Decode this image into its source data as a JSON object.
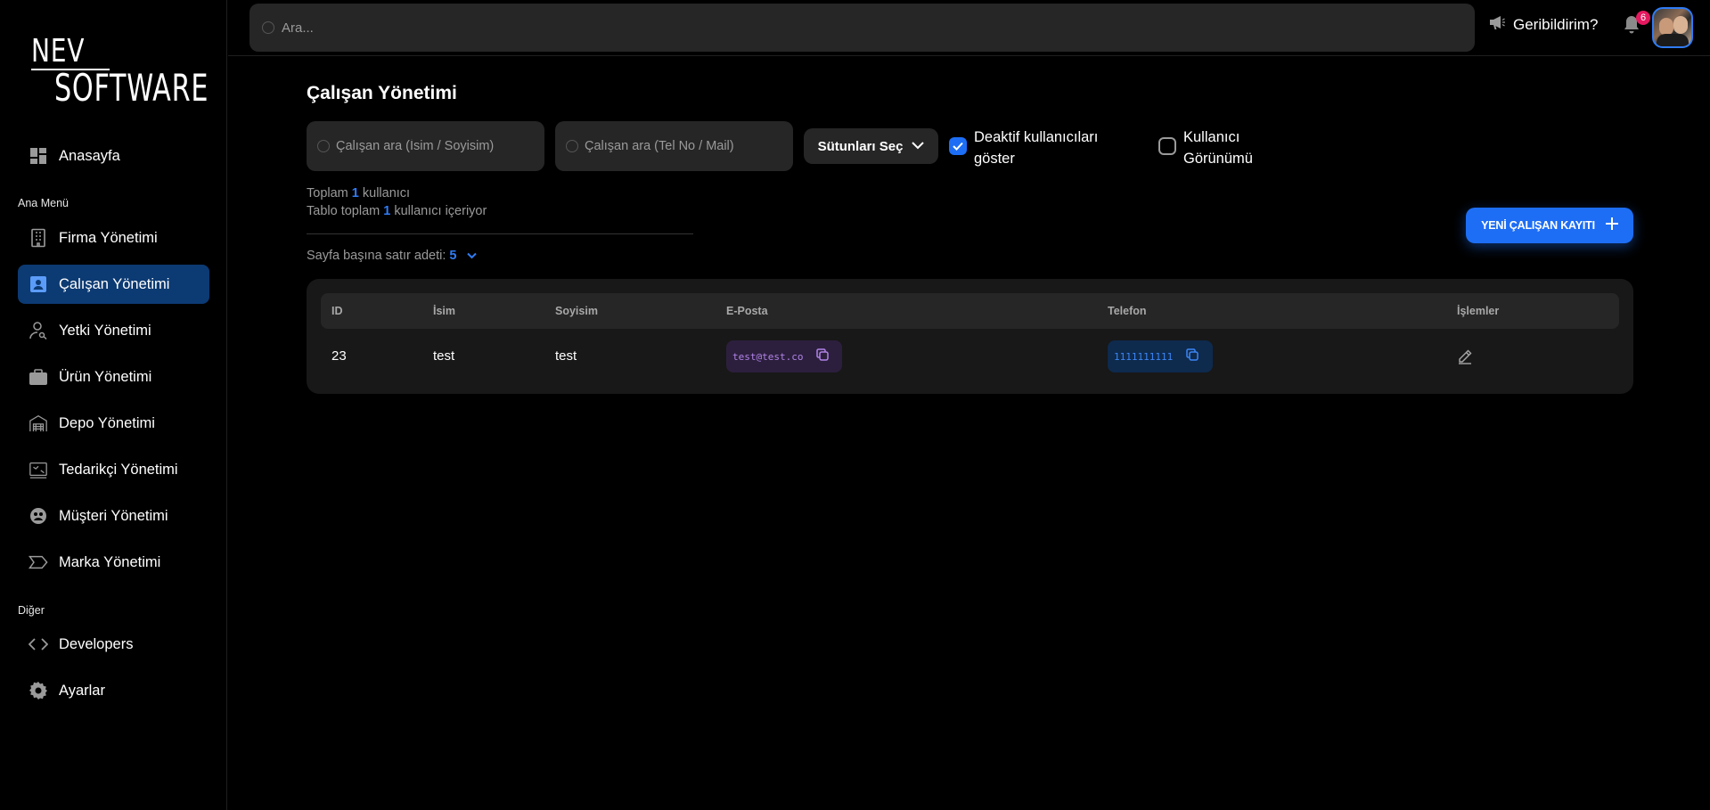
{
  "logo": {
    "line1": "NEV",
    "line2": "SOFTWARE"
  },
  "sidebar": {
    "home": {
      "label": "Anasayfa",
      "icon": "dashboard-icon"
    },
    "section_main": "Ana Menü",
    "items": [
      {
        "label": "Firma Yönetimi",
        "icon": "building-icon",
        "active": false
      },
      {
        "label": "Çalışan Yönetimi",
        "icon": "user-card-icon",
        "active": true
      },
      {
        "label": "Yetki Yönetimi",
        "icon": "user-key-icon",
        "active": false
      },
      {
        "label": "Ürün Yönetimi",
        "icon": "briefcase-icon",
        "active": false
      },
      {
        "label": "Depo Yönetimi",
        "icon": "warehouse-icon",
        "active": false
      },
      {
        "label": "Tedarikçi Yönetimi",
        "icon": "supplier-icon",
        "active": false
      },
      {
        "label": "Müşteri Yönetimi",
        "icon": "customer-icon",
        "active": false
      },
      {
        "label": "Marka Yönetimi",
        "icon": "tag-icon",
        "active": false
      }
    ],
    "section_other": "Diğer",
    "other_items": [
      {
        "label": "Developers",
        "icon": "code-icon"
      },
      {
        "label": "Ayarlar",
        "icon": "gear-icon"
      }
    ]
  },
  "topbar": {
    "search_placeholder": "Ara...",
    "feedback_label": "Geribildirim?",
    "notification_count": "6"
  },
  "main": {
    "title": "Çalışan Yönetimi",
    "search_name_placeholder": "Çalışan ara (İsim / Soyisim)",
    "search_contact_placeholder": "Çalışan ara (Tel No / Mail)",
    "columns_button": "Sütunları Seç",
    "show_inactive": {
      "line1": "Deaktif kullanıcıları",
      "line2": "göster",
      "checked": true
    },
    "user_view": {
      "line1": "Kullanıcı",
      "line2": "Görünümü",
      "checked": false
    },
    "total_prefix": "Toplam",
    "total_count": "1",
    "total_suffix": "kullanıcı",
    "table_total_prefix": "Tablo toplam",
    "table_total_count": "1",
    "table_total_suffix": "kullanıcı içeriyor",
    "rows_per_page_label": "Sayfa başına satır adeti:",
    "rows_per_page_value": "5",
    "new_button": "YENİ ÇALIŞAN KAYITI"
  },
  "table": {
    "headers": [
      "ID",
      "İsim",
      "Soyisim",
      "E-Posta",
      "Telefon",
      "İşlemler"
    ],
    "rows": [
      {
        "id": "23",
        "name": "test",
        "surname": "test",
        "email": "test@test.co",
        "phone": "1111111111"
      }
    ]
  },
  "colors": {
    "accent": "#1d6ef5",
    "active_nav": "#0c3a73",
    "badge": "#e5195f",
    "email_chip": "#2c1f3d",
    "phone_chip": "#0e2a4d"
  }
}
